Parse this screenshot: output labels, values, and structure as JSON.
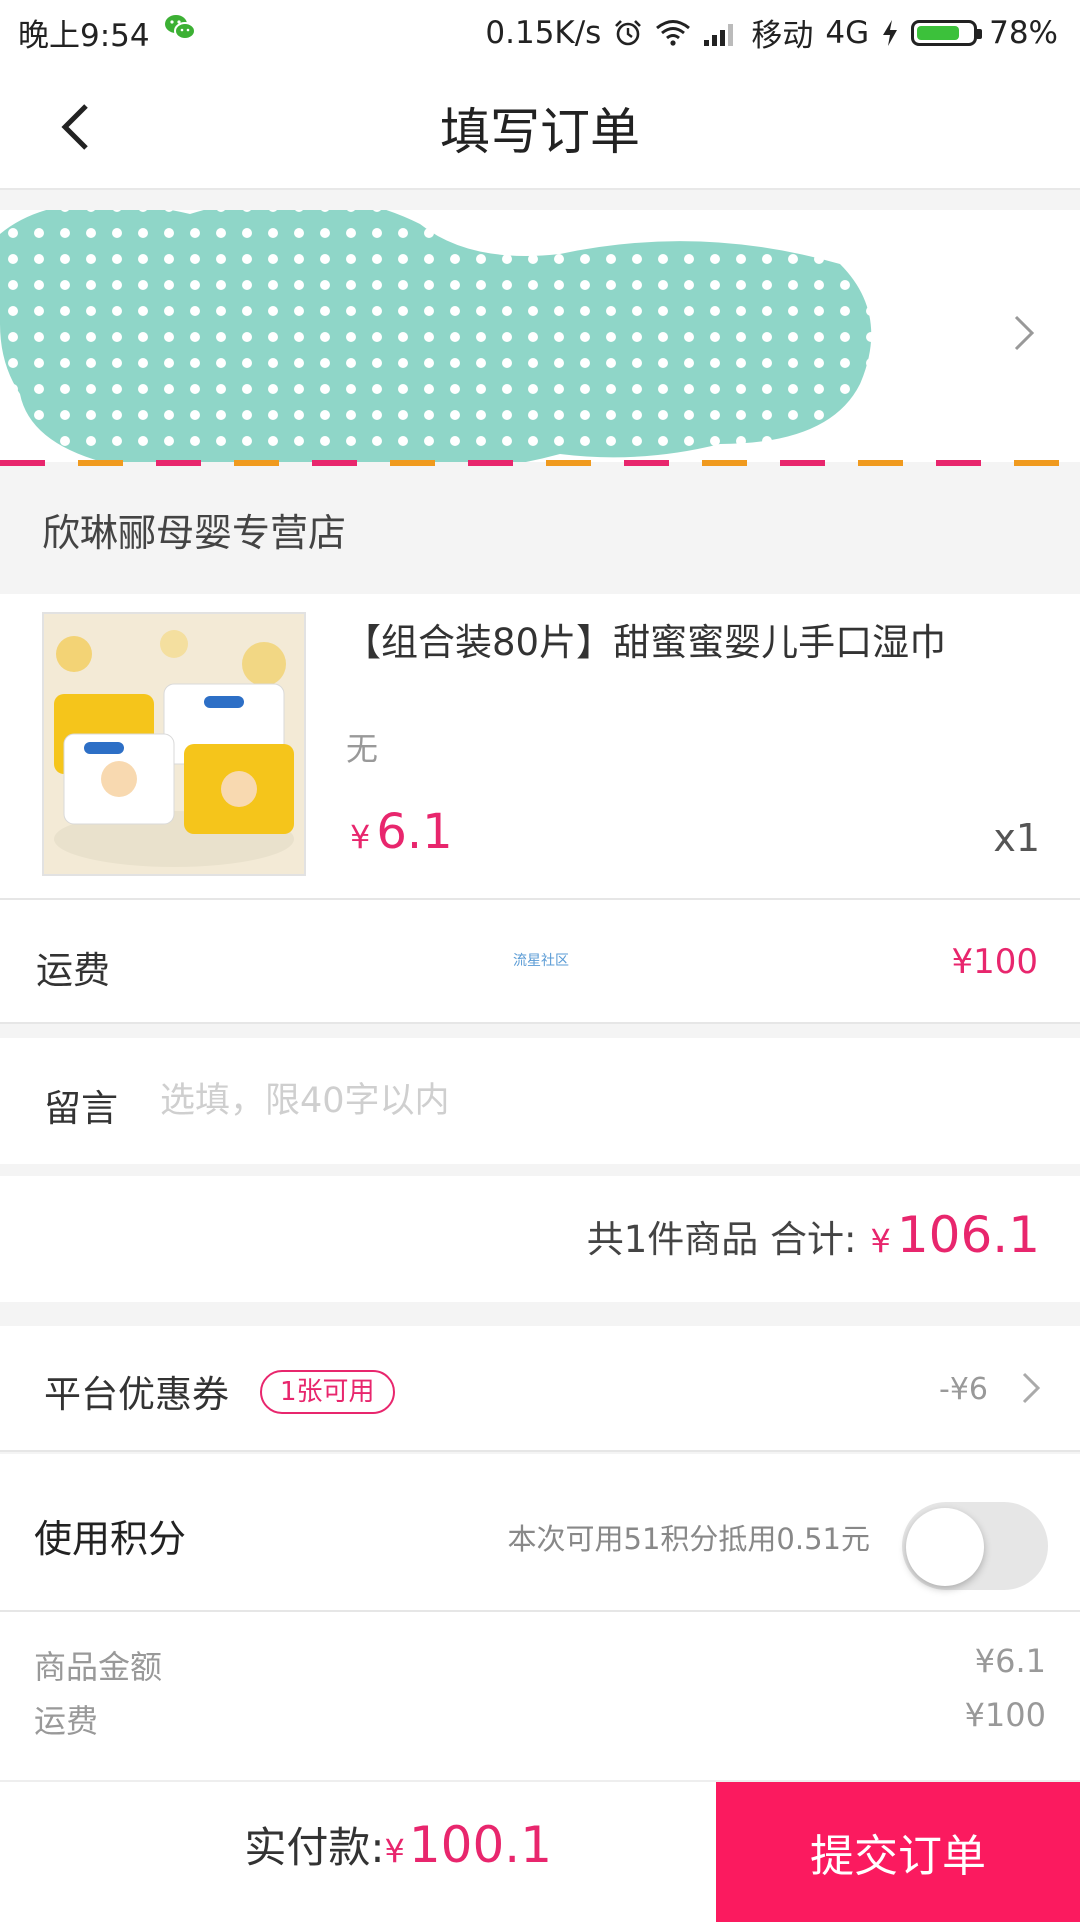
{
  "status_bar": {
    "time": "晚上9:54",
    "speed": "0.15K/s",
    "carrier": "移动",
    "network": "4G",
    "battery": "78%",
    "battery_level": 0.78,
    "icons": [
      "wechat-icon",
      "alarm-icon",
      "wifi-icon",
      "signal-icon",
      "charging-icon",
      "battery-icon"
    ]
  },
  "nav": {
    "title": "填写订单",
    "back_icon": "chevron-left-icon"
  },
  "address": {
    "icons": [
      "location-pin-icon",
      "chevron-right-icon"
    ],
    "stripe_colors": [
      "#e8266d",
      "#f09a1e"
    ]
  },
  "store": {
    "name": "欣琳郦母婴专营店"
  },
  "product": {
    "title": "【组合装80片】甜蜜蜜婴儿手口湿巾",
    "spec": "无",
    "currency": "¥",
    "price": "6.1",
    "quantity": "x1"
  },
  "shipping": {
    "label": "运费",
    "watermark": "流星社区",
    "value": "¥100"
  },
  "message": {
    "label": "留言",
    "placeholder": "选填，限40字以内",
    "value": ""
  },
  "total": {
    "text": "共1件商品 合计:",
    "currency": "¥",
    "amount": "106.1"
  },
  "coupon": {
    "label": "平台优惠券",
    "badge": "1张可用",
    "value": "-¥6"
  },
  "points": {
    "label": "使用积分",
    "description": "本次可用51积分抵用0.51元",
    "enabled": false
  },
  "summary": {
    "rows": [
      {
        "label": "商品金额",
        "value": "¥6.1"
      },
      {
        "label": "运费",
        "value": "¥100"
      }
    ]
  },
  "bottom": {
    "pay_label": "实付款:",
    "currency": "¥",
    "pay_amount": "100.1",
    "submit_label": "提交订单"
  },
  "colors": {
    "accent": "#e8266d",
    "submit_bg": "#fb1a5f",
    "toggle_off": "#e6e6e6"
  }
}
